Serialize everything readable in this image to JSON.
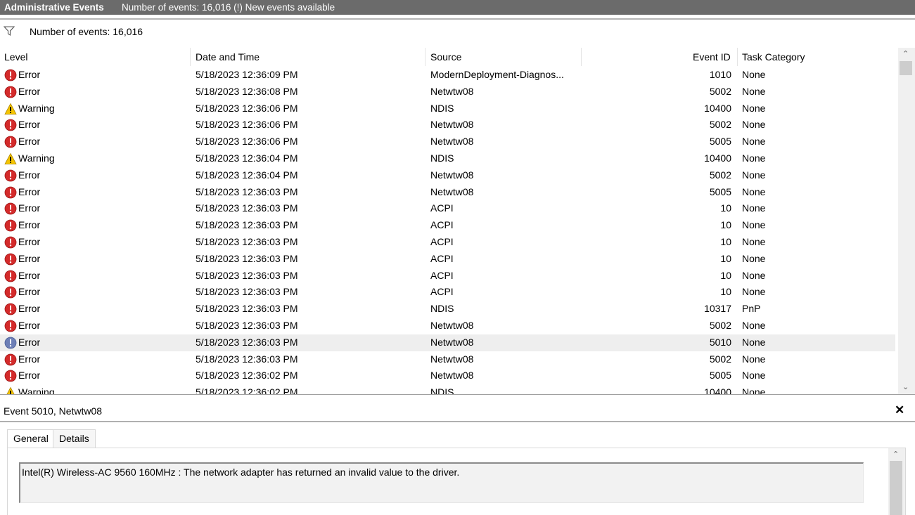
{
  "title_bar": {
    "title": "Administrative Events",
    "info": "Number of events: 16,016 (!) New events available"
  },
  "filter_bar": {
    "count_text": "Number of events: 16,016"
  },
  "table": {
    "columns": [
      "Level",
      "Date and Time",
      "Source",
      "Event ID",
      "Task Category"
    ],
    "rows": [
      {
        "level": "Error",
        "date": "5/18/2023 12:36:09 PM",
        "source": "ModernDeployment-Diagnos...",
        "id": "1010",
        "task": "None"
      },
      {
        "level": "Error",
        "date": "5/18/2023 12:36:08 PM",
        "source": "Netwtw08",
        "id": "5002",
        "task": "None"
      },
      {
        "level": "Warning",
        "date": "5/18/2023 12:36:06 PM",
        "source": "NDIS",
        "id": "10400",
        "task": "None"
      },
      {
        "level": "Error",
        "date": "5/18/2023 12:36:06 PM",
        "source": "Netwtw08",
        "id": "5002",
        "task": "None"
      },
      {
        "level": "Error",
        "date": "5/18/2023 12:36:06 PM",
        "source": "Netwtw08",
        "id": "5005",
        "task": "None"
      },
      {
        "level": "Warning",
        "date": "5/18/2023 12:36:04 PM",
        "source": "NDIS",
        "id": "10400",
        "task": "None"
      },
      {
        "level": "Error",
        "date": "5/18/2023 12:36:04 PM",
        "source": "Netwtw08",
        "id": "5002",
        "task": "None"
      },
      {
        "level": "Error",
        "date": "5/18/2023 12:36:03 PM",
        "source": "Netwtw08",
        "id": "5005",
        "task": "None"
      },
      {
        "level": "Error",
        "date": "5/18/2023 12:36:03 PM",
        "source": "ACPI",
        "id": "10",
        "task": "None"
      },
      {
        "level": "Error",
        "date": "5/18/2023 12:36:03 PM",
        "source": "ACPI",
        "id": "10",
        "task": "None"
      },
      {
        "level": "Error",
        "date": "5/18/2023 12:36:03 PM",
        "source": "ACPI",
        "id": "10",
        "task": "None"
      },
      {
        "level": "Error",
        "date": "5/18/2023 12:36:03 PM",
        "source": "ACPI",
        "id": "10",
        "task": "None"
      },
      {
        "level": "Error",
        "date": "5/18/2023 12:36:03 PM",
        "source": "ACPI",
        "id": "10",
        "task": "None"
      },
      {
        "level": "Error",
        "date": "5/18/2023 12:36:03 PM",
        "source": "ACPI",
        "id": "10",
        "task": "None"
      },
      {
        "level": "Error",
        "date": "5/18/2023 12:36:03 PM",
        "source": "NDIS",
        "id": "10317",
        "task": "PnP"
      },
      {
        "level": "Error",
        "date": "5/18/2023 12:36:03 PM",
        "source": "Netwtw08",
        "id": "5002",
        "task": "None"
      },
      {
        "level": "Error",
        "date": "5/18/2023 12:36:03 PM",
        "source": "Netwtw08",
        "id": "5010",
        "task": "None",
        "selected": true
      },
      {
        "level": "Error",
        "date": "5/18/2023 12:36:03 PM",
        "source": "Netwtw08",
        "id": "5002",
        "task": "None"
      },
      {
        "level": "Error",
        "date": "5/18/2023 12:36:02 PM",
        "source": "Netwtw08",
        "id": "5005",
        "task": "None"
      },
      {
        "level": "Warning",
        "date": "5/18/2023 12:36:02 PM",
        "source": "NDIS",
        "id": "10400",
        "task": "None"
      }
    ]
  },
  "detail": {
    "title": "Event 5010, Netwtw08",
    "close_glyph": "✕",
    "tabs": [
      {
        "label": "General"
      },
      {
        "label": "Details"
      }
    ],
    "message": "Intel(R) Wireless-AC 9560 160MHz : The network adapter has returned an invalid value to the driver."
  },
  "colors": {
    "error": "#d42b2b",
    "warning": "#f5c400",
    "titlebar": "#6b6b6b"
  }
}
